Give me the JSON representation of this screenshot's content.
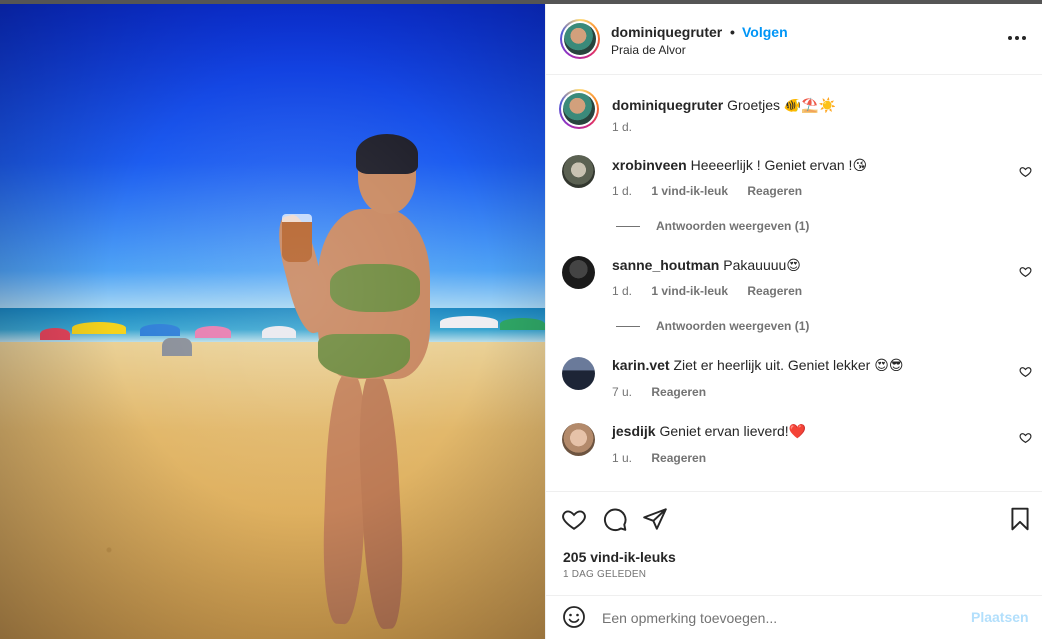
{
  "post": {
    "author": "dominiquegruter",
    "follow_label": "Volgen",
    "separator": "•",
    "location": "Praia de Alvor",
    "caption": "Groetjes 🐠⛱️☀️",
    "caption_age": "1 d."
  },
  "comments": [
    {
      "user": "xrobinveen",
      "text": "Heeeerlijk ! Geniet ervan !😘",
      "age": "1 d.",
      "likes": "1 vind-ik-leuk",
      "reply": "Reageren",
      "replies": "Antwoorden weergeven (1)"
    },
    {
      "user": "sanne_houtman",
      "text": "Pakauuuu😍",
      "age": "1 d.",
      "likes": "1 vind-ik-leuk",
      "reply": "Reageren",
      "replies": "Antwoorden weergeven (1)"
    },
    {
      "user": "karin.vet",
      "text": "Ziet er heerlijk uit. Geniet lekker 😍😎",
      "age": "7 u.",
      "reply": "Reageren"
    },
    {
      "user": "jesdijk",
      "text": "Geniet ervan lieverd!❤️",
      "age": "1 u.",
      "reply": "Reageren"
    }
  ],
  "stats": {
    "likes": "205 vind-ik-leuks",
    "date": "1 DAG GELEDEN"
  },
  "add_comment": {
    "placeholder": "Een opmerking toevoegen...",
    "post_label": "Plaatsen"
  },
  "icons": {
    "more": "more-options-icon",
    "like": "heart-icon",
    "comment": "comment-icon",
    "share": "share-icon",
    "save": "bookmark-icon",
    "emoji": "emoji-icon"
  },
  "colors": {
    "accent": "#0095f6",
    "post_disabled": "#b2dffc",
    "muted": "#737373"
  }
}
